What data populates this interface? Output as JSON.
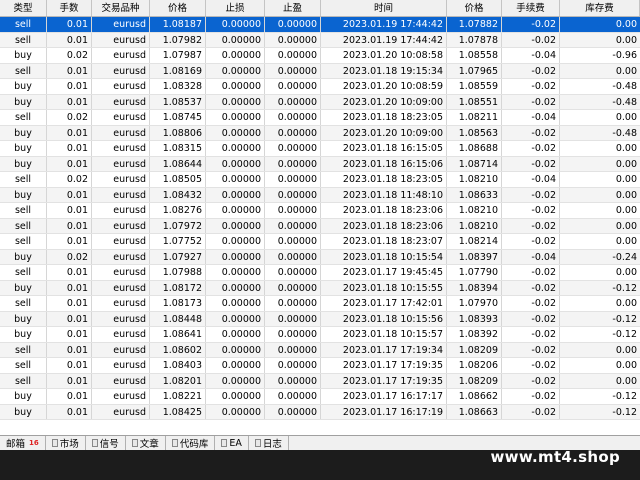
{
  "headers": [
    "类型",
    "手数",
    "交易品种",
    "价格",
    "止损",
    "止盈",
    "时间",
    "价格",
    "手续费",
    "库存费"
  ],
  "rows": [
    [
      "sell",
      "0.01",
      "eurusd",
      "1.08187",
      "0.00000",
      "0.00000",
      "2023.01.19 17:44:42",
      "1.07882",
      "-0.02",
      "0.00"
    ],
    [
      "sell",
      "0.01",
      "eurusd",
      "1.07982",
      "0.00000",
      "0.00000",
      "2023.01.19 17:44:42",
      "1.07878",
      "-0.02",
      "0.00"
    ],
    [
      "buy",
      "0.02",
      "eurusd",
      "1.07987",
      "0.00000",
      "0.00000",
      "2023.01.20 10:08:58",
      "1.08558",
      "-0.04",
      "-0.96"
    ],
    [
      "sell",
      "0.01",
      "eurusd",
      "1.08169",
      "0.00000",
      "0.00000",
      "2023.01.18 19:15:34",
      "1.07965",
      "-0.02",
      "0.00"
    ],
    [
      "buy",
      "0.01",
      "eurusd",
      "1.08328",
      "0.00000",
      "0.00000",
      "2023.01.20 10:08:59",
      "1.08559",
      "-0.02",
      "-0.48"
    ],
    [
      "buy",
      "0.01",
      "eurusd",
      "1.08537",
      "0.00000",
      "0.00000",
      "2023.01.20 10:09:00",
      "1.08551",
      "-0.02",
      "-0.48"
    ],
    [
      "sell",
      "0.02",
      "eurusd",
      "1.08745",
      "0.00000",
      "0.00000",
      "2023.01.18 18:23:05",
      "1.08211",
      "-0.04",
      "0.00"
    ],
    [
      "buy",
      "0.01",
      "eurusd",
      "1.08806",
      "0.00000",
      "0.00000",
      "2023.01.20 10:09:00",
      "1.08563",
      "-0.02",
      "-0.48"
    ],
    [
      "buy",
      "0.01",
      "eurusd",
      "1.08315",
      "0.00000",
      "0.00000",
      "2023.01.18 16:15:05",
      "1.08688",
      "-0.02",
      "0.00"
    ],
    [
      "buy",
      "0.01",
      "eurusd",
      "1.08644",
      "0.00000",
      "0.00000",
      "2023.01.18 16:15:06",
      "1.08714",
      "-0.02",
      "0.00"
    ],
    [
      "sell",
      "0.02",
      "eurusd",
      "1.08505",
      "0.00000",
      "0.00000",
      "2023.01.18 18:23:05",
      "1.08210",
      "-0.04",
      "0.00"
    ],
    [
      "buy",
      "0.01",
      "eurusd",
      "1.08432",
      "0.00000",
      "0.00000",
      "2023.01.18 11:48:10",
      "1.08633",
      "-0.02",
      "0.00"
    ],
    [
      "sell",
      "0.01",
      "eurusd",
      "1.08276",
      "0.00000",
      "0.00000",
      "2023.01.18 18:23:06",
      "1.08210",
      "-0.02",
      "0.00"
    ],
    [
      "sell",
      "0.01",
      "eurusd",
      "1.07972",
      "0.00000",
      "0.00000",
      "2023.01.18 18:23:06",
      "1.08210",
      "-0.02",
      "0.00"
    ],
    [
      "sell",
      "0.01",
      "eurusd",
      "1.07752",
      "0.00000",
      "0.00000",
      "2023.01.18 18:23:07",
      "1.08214",
      "-0.02",
      "0.00"
    ],
    [
      "buy",
      "0.02",
      "eurusd",
      "1.07927",
      "0.00000",
      "0.00000",
      "2023.01.18 10:15:54",
      "1.08397",
      "-0.04",
      "-0.24"
    ],
    [
      "sell",
      "0.01",
      "eurusd",
      "1.07988",
      "0.00000",
      "0.00000",
      "2023.01.17 19:45:45",
      "1.07790",
      "-0.02",
      "0.00"
    ],
    [
      "buy",
      "0.01",
      "eurusd",
      "1.08172",
      "0.00000",
      "0.00000",
      "2023.01.18 10:15:55",
      "1.08394",
      "-0.02",
      "-0.12"
    ],
    [
      "sell",
      "0.01",
      "eurusd",
      "1.08173",
      "0.00000",
      "0.00000",
      "2023.01.17 17:42:01",
      "1.07970",
      "-0.02",
      "0.00"
    ],
    [
      "buy",
      "0.01",
      "eurusd",
      "1.08448",
      "0.00000",
      "0.00000",
      "2023.01.18 10:15:56",
      "1.08393",
      "-0.02",
      "-0.12"
    ],
    [
      "buy",
      "0.01",
      "eurusd",
      "1.08641",
      "0.00000",
      "0.00000",
      "2023.01.18 10:15:57",
      "1.08392",
      "-0.02",
      "-0.12"
    ],
    [
      "sell",
      "0.01",
      "eurusd",
      "1.08602",
      "0.00000",
      "0.00000",
      "2023.01.17 17:19:34",
      "1.08209",
      "-0.02",
      "0.00"
    ],
    [
      "sell",
      "0.01",
      "eurusd",
      "1.08403",
      "0.00000",
      "0.00000",
      "2023.01.17 17:19:35",
      "1.08206",
      "-0.02",
      "0.00"
    ],
    [
      "sell",
      "0.01",
      "eurusd",
      "1.08201",
      "0.00000",
      "0.00000",
      "2023.01.17 17:19:35",
      "1.08209",
      "-0.02",
      "0.00"
    ],
    [
      "buy",
      "0.01",
      "eurusd",
      "1.08221",
      "0.00000",
      "0.00000",
      "2023.01.17 16:17:17",
      "1.08662",
      "-0.02",
      "-0.12"
    ],
    [
      "buy",
      "0.01",
      "eurusd",
      "1.08425",
      "0.00000",
      "0.00000",
      "2023.01.17 16:17:19",
      "1.08663",
      "-0.02",
      "-0.12"
    ]
  ],
  "tabs": [
    {
      "label": "邮箱",
      "badge": "16"
    },
    {
      "label": "市场"
    },
    {
      "label": "信号"
    },
    {
      "label": "文章"
    },
    {
      "label": "代码库"
    },
    {
      "label": "EA"
    },
    {
      "label": "日志"
    }
  ],
  "watermark": "www.mt4.shop",
  "colors": {
    "selected_row": "#0a64d0",
    "alt_row": "#f4f4f4",
    "badge": "#d22222"
  }
}
